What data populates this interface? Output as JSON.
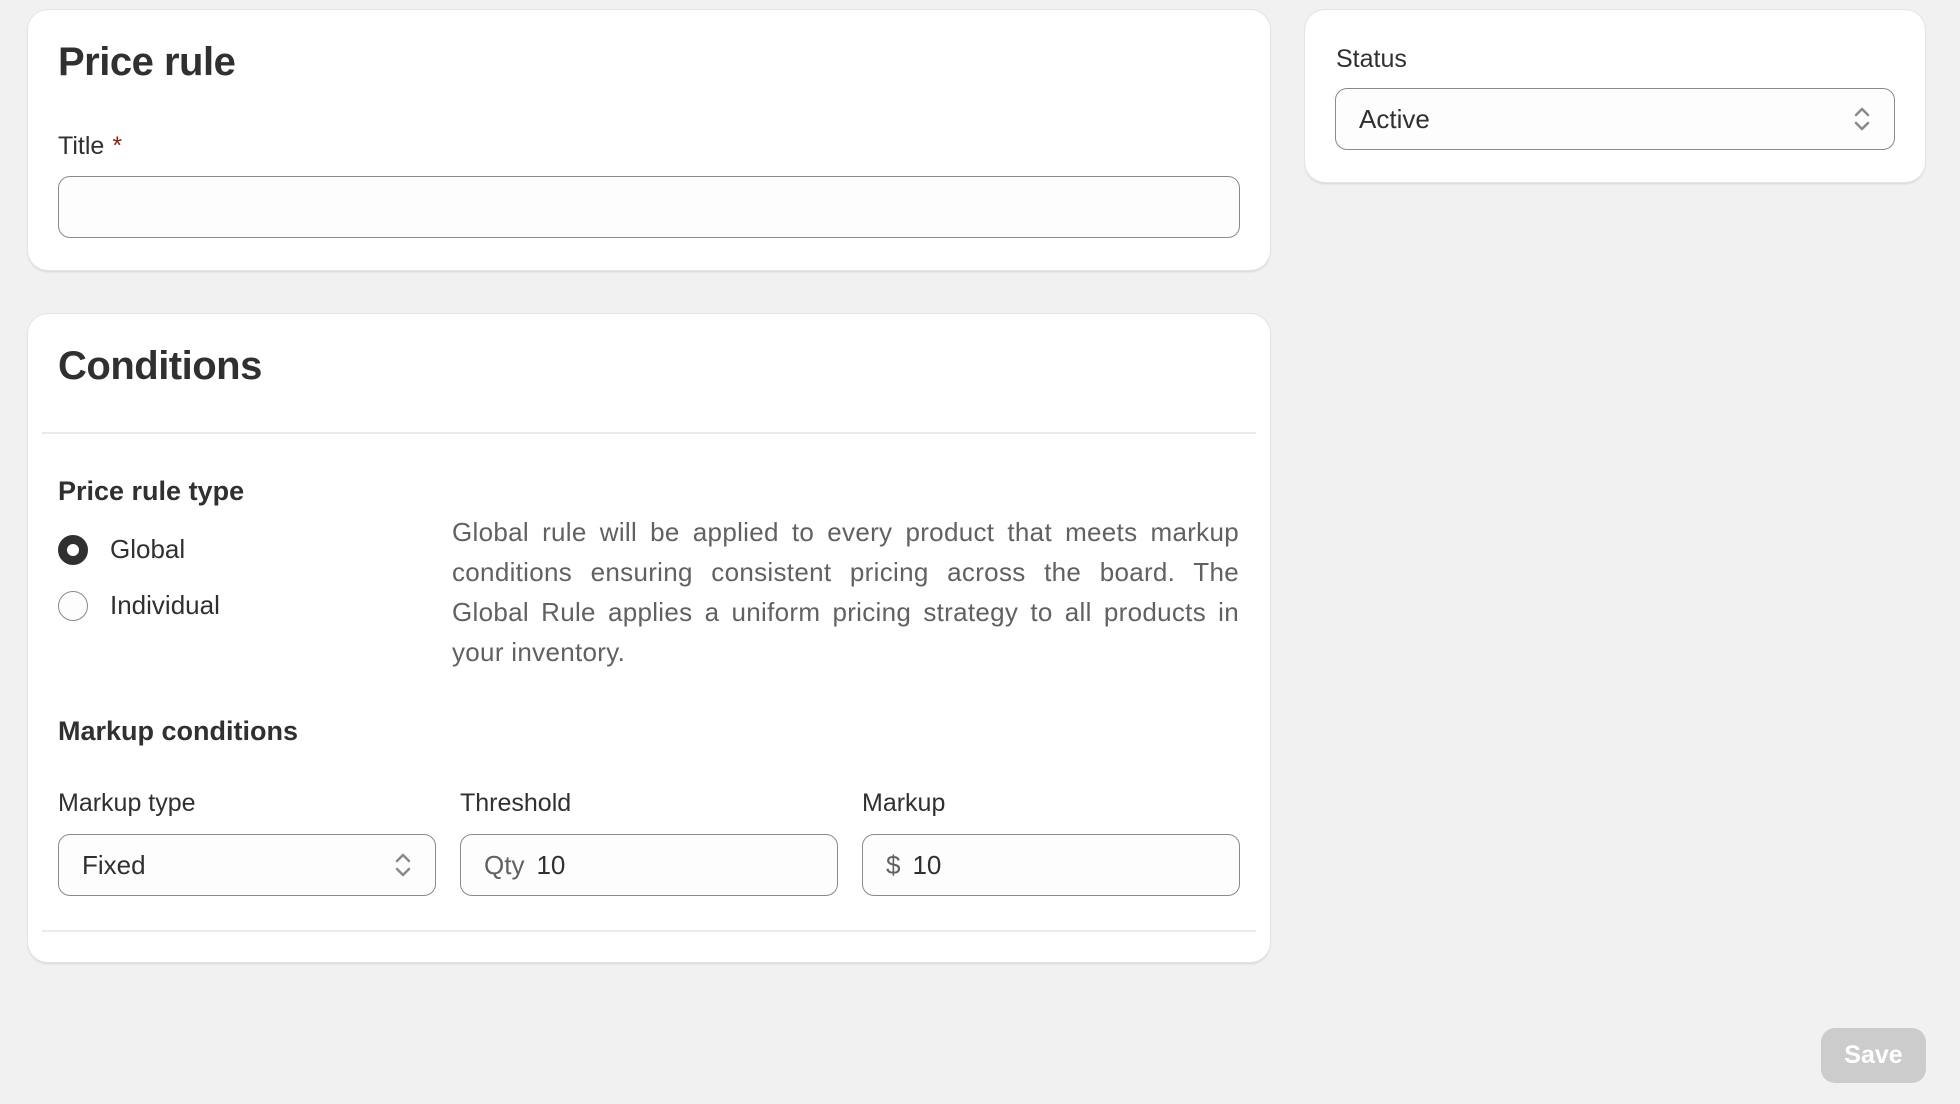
{
  "price_rule_card": {
    "title": "Price rule",
    "title_field": {
      "label": "Title",
      "required_mark": "*",
      "value": "",
      "placeholder": ""
    }
  },
  "status_card": {
    "label": "Status",
    "selected": "Active"
  },
  "conditions_card": {
    "title": "Conditions",
    "price_rule_type": {
      "heading": "Price rule type",
      "options": [
        {
          "label": "Global",
          "selected": true
        },
        {
          "label": "Individual",
          "selected": false
        }
      ],
      "description": "Global rule will be applied to every product that meets markup conditions ensuring consistent pricing across the board. The Global Rule applies a uniform pricing strategy to all products in your inventory."
    },
    "markup_conditions": {
      "heading": "Markup conditions",
      "markup_type": {
        "label": "Markup type",
        "selected": "Fixed"
      },
      "threshold": {
        "label": "Threshold",
        "prefix": "Qty",
        "value": "10"
      },
      "markup": {
        "label": "Markup",
        "prefix": "$",
        "value": "10"
      }
    }
  },
  "footer": {
    "save_label": "Save"
  },
  "colors": {
    "background": "#f1f1f1",
    "text": "#303030",
    "required": "#8e1f0b",
    "save_disabled": "#cccccc"
  }
}
